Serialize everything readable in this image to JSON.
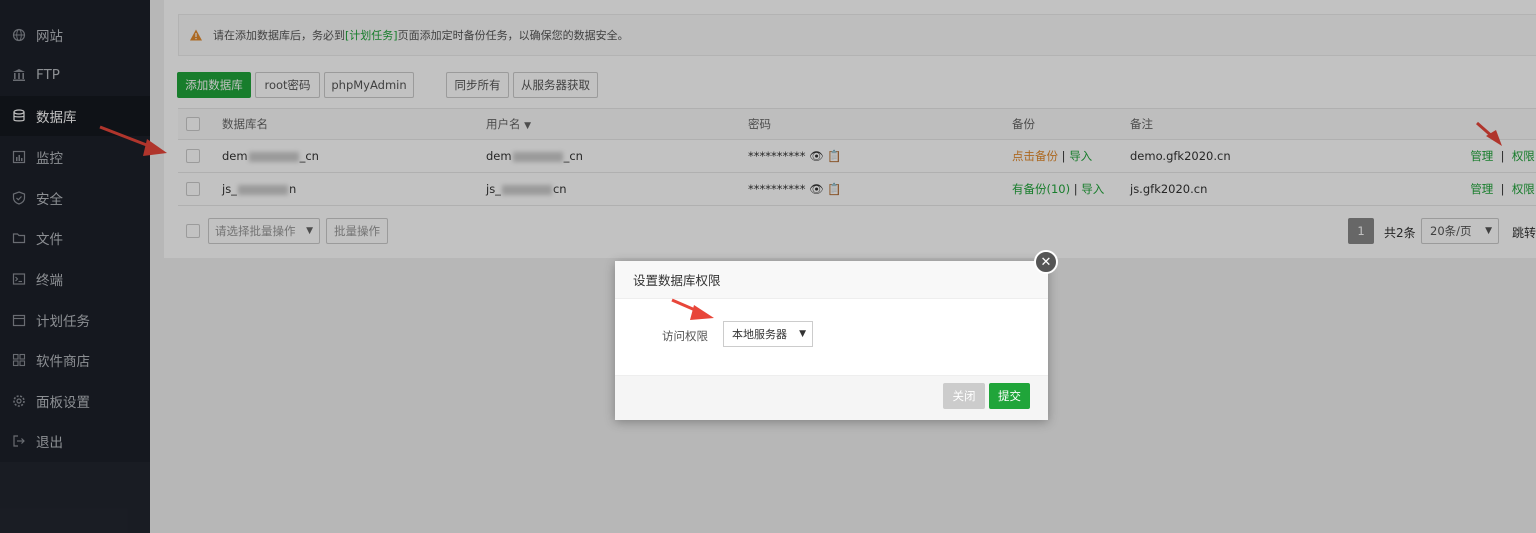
{
  "sidebar": {
    "items": [
      {
        "label": "网站",
        "icon": "globe-icon"
      },
      {
        "label": "FTP",
        "icon": "ftp-icon"
      },
      {
        "label": "数据库",
        "icon": "database-icon",
        "active": true
      },
      {
        "label": "监控",
        "icon": "monitor-icon"
      },
      {
        "label": "安全",
        "icon": "shield-icon"
      },
      {
        "label": "文件",
        "icon": "folder-icon"
      },
      {
        "label": "终端",
        "icon": "terminal-icon"
      },
      {
        "label": "计划任务",
        "icon": "calendar-icon"
      },
      {
        "label": "软件商店",
        "icon": "apps-icon"
      },
      {
        "label": "面板设置",
        "icon": "gear-icon"
      },
      {
        "label": "退出",
        "icon": "logout-icon"
      }
    ]
  },
  "notice": {
    "prefix": "请在添加数据库后，务必到",
    "link": "[计划任务]",
    "suffix": "页面添加定时备份任务，以确保您的数据安全。"
  },
  "toolbar": {
    "add_db": "添加数据库",
    "root_pwd": "root密码",
    "phpmyadmin": "phpMyAdmin",
    "sync_all": "同步所有",
    "from_server": "从服务器获取"
  },
  "table": {
    "headers": [
      "数据库名",
      "用户名",
      "密码",
      "备份",
      "备注"
    ],
    "rows": [
      {
        "name_a": "dem",
        "name_b": "_cn",
        "user_a": "dem",
        "user_b": "_cn",
        "password": "**********",
        "backup": "点击备份",
        "import": "导入",
        "note": "demo.gfk2020.cn",
        "manage": "管理",
        "perm": "权限"
      },
      {
        "name_a": "js_",
        "name_b": "n",
        "user_a": "js_",
        "user_b": "cn",
        "password": "**********",
        "backup": "有备份(10)",
        "import": "导入",
        "note": "js.gfk2020.cn",
        "manage": "管理",
        "perm": "权限"
      }
    ]
  },
  "footer": {
    "batch_placeholder": "请选择批量操作",
    "batch_button": "批量操作",
    "page": "1",
    "total": "共2条",
    "per_page": "20条/页",
    "jump": "跳转"
  },
  "dialog": {
    "title": "设置数据库权限",
    "field_label": "访问权限",
    "selected": "本地服务器",
    "close": "关闭",
    "submit": "提交"
  },
  "colors": {
    "accent": "#20a53a",
    "sidebar": "#1c2029",
    "annotation": "#e8463a"
  }
}
